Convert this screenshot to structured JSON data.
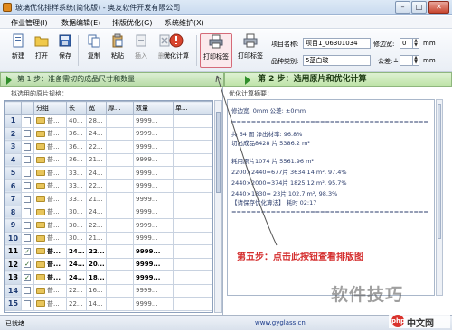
{
  "window": {
    "title": "玻璃优化排样系统(简化版) - 奥友软件开发有限公司",
    "minimize": "–",
    "maximize": "□",
    "close": "✕"
  },
  "menu": [
    "作业管理(I)",
    "数据编辑(E)",
    "排版优化(G)",
    "系统维护(X)"
  ],
  "toolbar": {
    "buttons": [
      {
        "label": "新建",
        "icon": "new-file-icon"
      },
      {
        "label": "打开",
        "icon": "open-folder-icon"
      },
      {
        "label": "保存",
        "icon": "save-icon"
      },
      {
        "label": "复制",
        "icon": "copy-icon"
      },
      {
        "label": "粘贴",
        "icon": "paste-icon"
      },
      {
        "label": "插入",
        "icon": "insert-icon"
      },
      {
        "label": "删除",
        "icon": "delete-icon"
      },
      {
        "label": "优化计算",
        "icon": "optimize-icon"
      },
      {
        "label": "打印标签",
        "icon": "printer-icon"
      },
      {
        "label": "打印标签",
        "icon": "print-label-icon"
      }
    ],
    "project_name_label": "项目名称:",
    "project_name_value": "项目1_06301034",
    "variety_label": "品种类别:",
    "variety_value": "5蓝白玻",
    "edge_margin_label": "修边宽:",
    "edge_margin_value": "0",
    "edge_margin_unit": "mm",
    "tolerance_label": "公差:",
    "tolerance_value": "±",
    "tolerance_unit": "mm"
  },
  "steps": {
    "step1": "第 1 步：准备需切的成品尺寸和数量",
    "step2": "第 2 步：选用原片和优化计算"
  },
  "left": {
    "title": "拟选用的原片规格：",
    "headers": [
      "",
      "",
      "分组",
      "长",
      "宽",
      "厚...",
      "数量",
      "单..."
    ],
    "rows": [
      {
        "num": "1",
        "checked": false,
        "group": "普...",
        "c1": "40...",
        "c2": "28...",
        "c3": "",
        "qty": "9999...",
        "bold": false
      },
      {
        "num": "2",
        "checked": false,
        "group": "普...",
        "c1": "36...",
        "c2": "24...",
        "c3": "",
        "qty": "9999...",
        "bold": false
      },
      {
        "num": "3",
        "checked": false,
        "group": "普...",
        "c1": "36...",
        "c2": "22...",
        "c3": "",
        "qty": "9999...",
        "bold": false
      },
      {
        "num": "4",
        "checked": false,
        "group": "普...",
        "c1": "36...",
        "c2": "21...",
        "c3": "",
        "qty": "9999...",
        "bold": false
      },
      {
        "num": "5",
        "checked": false,
        "group": "普...",
        "c1": "33...",
        "c2": "24...",
        "c3": "",
        "qty": "9999...",
        "bold": false
      },
      {
        "num": "6",
        "checked": false,
        "group": "普...",
        "c1": "33...",
        "c2": "22...",
        "c3": "",
        "qty": "9999...",
        "bold": false
      },
      {
        "num": "7",
        "checked": false,
        "group": "普...",
        "c1": "33...",
        "c2": "21...",
        "c3": "",
        "qty": "9999...",
        "bold": false
      },
      {
        "num": "8",
        "checked": false,
        "group": "普...",
        "c1": "30...",
        "c2": "24...",
        "c3": "",
        "qty": "9999...",
        "bold": false
      },
      {
        "num": "9",
        "checked": false,
        "group": "普...",
        "c1": "30...",
        "c2": "22...",
        "c3": "",
        "qty": "9999...",
        "bold": false
      },
      {
        "num": "10",
        "checked": false,
        "group": "普...",
        "c1": "30...",
        "c2": "21...",
        "c3": "",
        "qty": "9999...",
        "bold": false
      },
      {
        "num": "11",
        "checked": true,
        "group": "普...",
        "c1": "24...",
        "c2": "22...",
        "c3": "",
        "qty": "9999...",
        "bold": true
      },
      {
        "num": "12",
        "checked": true,
        "group": "普...",
        "c1": "24...",
        "c2": "20...",
        "c3": "",
        "qty": "9999...",
        "bold": true
      },
      {
        "num": "13",
        "checked": true,
        "group": "普...",
        "c1": "24...",
        "c2": "18...",
        "c3": "",
        "qty": "9999...",
        "bold": true
      },
      {
        "num": "14",
        "checked": false,
        "group": "普...",
        "c1": "22...",
        "c2": "16...",
        "c3": "",
        "qty": "9999...",
        "bold": false
      },
      {
        "num": "15",
        "checked": false,
        "group": "普...",
        "c1": "22...",
        "c2": "14...",
        "c3": "",
        "qty": "9999...",
        "bold": false
      }
    ]
  },
  "right": {
    "title": "优化计算摘要：",
    "lines": [
      "修边宽: 0mm        公差: ±0mm",
      "========================================",
      "共 64 图 净出材率: 96.8%",
      "切出成品8428 片   5386.2 m²",
      "",
      "耗用原片1074 片   5561.96 m²",
      "  2200×2440=677片 3634.14 m², 97.4%",
      "  2440×2000=374片 1825.12 m², 95.7%",
      "  2440×1830= 23片  102.7 m², 98.3%",
      "  【请保存优化算法】  耗时 02:17",
      "========================================"
    ],
    "annotation": "第五步：点击此按钮查看排版图"
  },
  "status": {
    "left": "已就绪",
    "url": "www.gyglass.cn"
  },
  "watermark": {
    "big": "软件技巧",
    "logo": "php",
    "site": "中文网"
  },
  "colors": {
    "accent": "#2f8d2a",
    "annotation": "#d42c2c"
  }
}
